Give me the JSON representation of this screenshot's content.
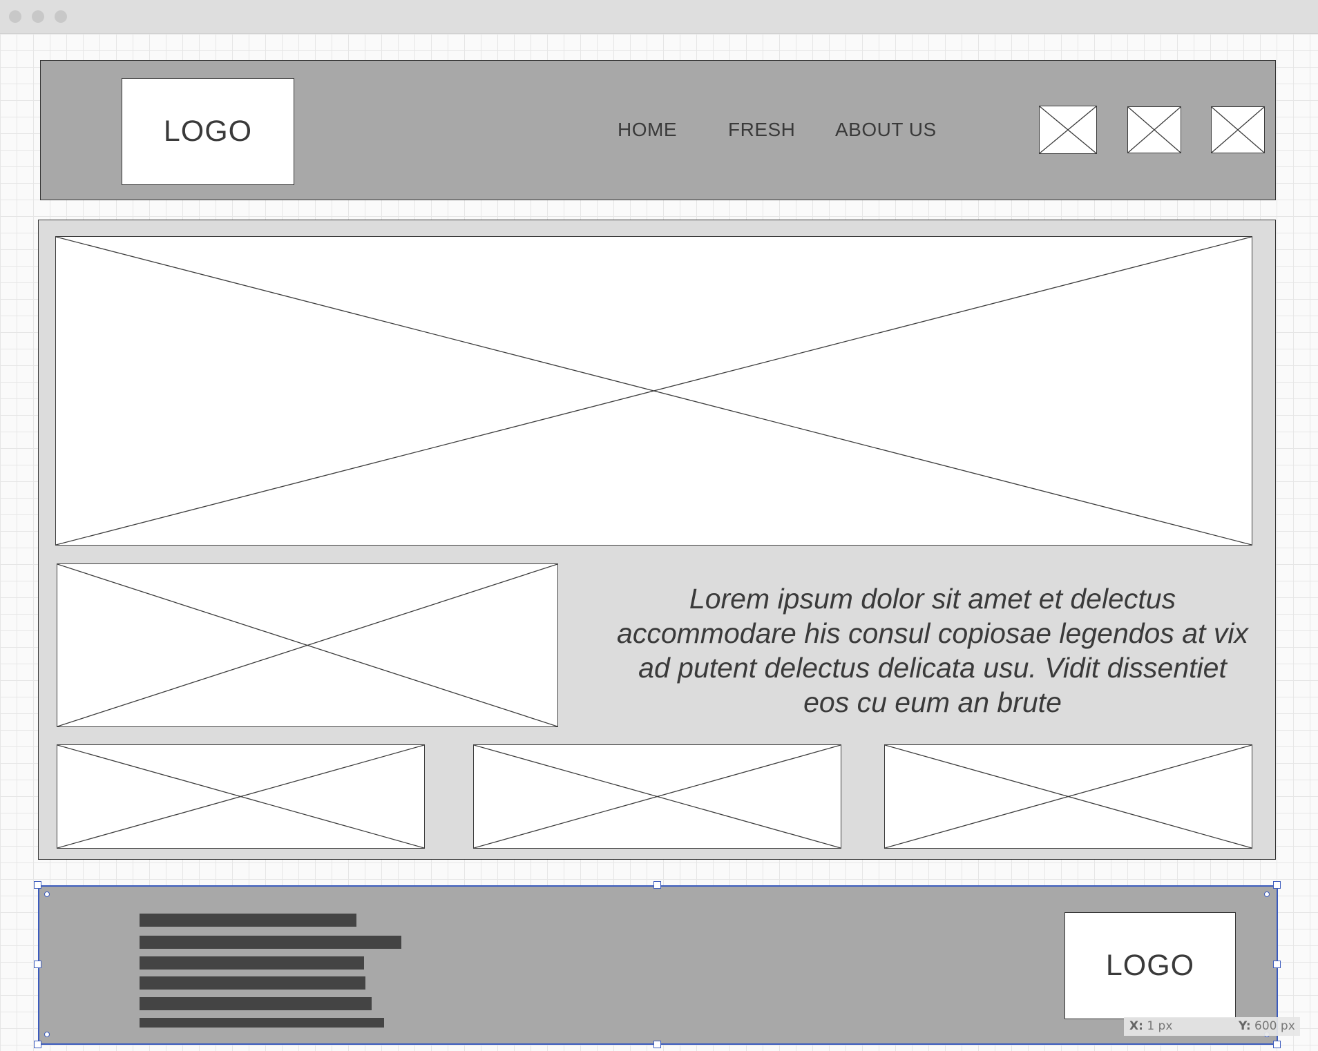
{
  "header": {
    "logo": "LOGO",
    "nav": [
      {
        "label": "HOME"
      },
      {
        "label": "FRESH"
      },
      {
        "label": "ABOUT US"
      }
    ]
  },
  "main": {
    "lorem": "Lorem ipsum dolor sit amet et delectus accommodare his consul copiosae legendos at vix ad putent delectus delicata usu. Vidit dissentiet eos cu eum an brute"
  },
  "footer": {
    "logo": "LOGO",
    "text_bar_count": 6
  },
  "statusbar": {
    "x_label": "X:",
    "x_value": "1 px",
    "y_label": "Y:",
    "y_value": "600 px"
  },
  "colors": {
    "header_fill": "#a8a8a8",
    "content_fill": "#dcdcdc",
    "footer_fill": "#a8a8a8",
    "selection": "#3b5bbd",
    "text": "#3a3a3a"
  }
}
